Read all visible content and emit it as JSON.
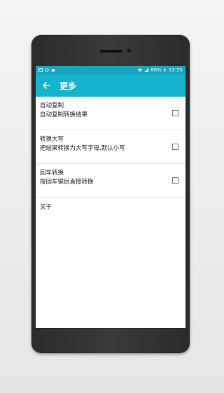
{
  "status": {
    "battery_text": "86%",
    "time": "13:55"
  },
  "appbar": {
    "title": "更多"
  },
  "settings": [
    {
      "title": "自动复制",
      "subtitle": "自动复制转换结果",
      "checked": false
    },
    {
      "title": "转换大写",
      "subtitle": "把结果转换为大写字母,默认小写",
      "checked": false
    },
    {
      "title": "回车转换",
      "subtitle": "按回车键后直接转换",
      "checked": false
    }
  ],
  "about_label": "关于",
  "colors": {
    "statusbar": "#1aa4bd",
    "appbar": "#16b3cf"
  }
}
